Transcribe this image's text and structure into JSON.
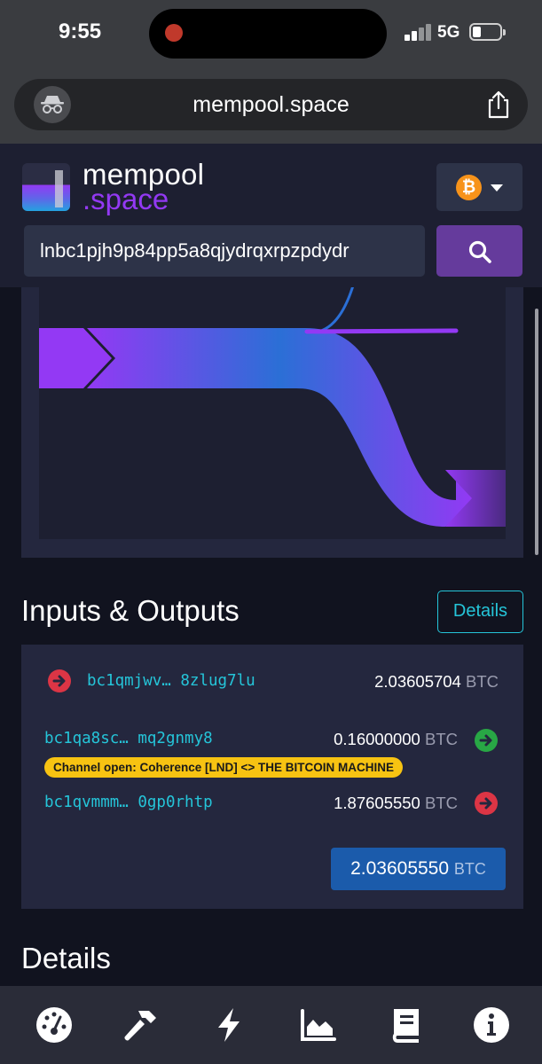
{
  "status_bar": {
    "time": "9:55",
    "network": "5G"
  },
  "browser": {
    "url": "mempool.space"
  },
  "header": {
    "logo_line1": "mempool",
    "logo_line2": ".space",
    "search_value": "lnbc1pjh9p84pp5a8qjydrqxrpzpdydr",
    "network_symbol": "₿"
  },
  "io": {
    "title": "Inputs & Outputs",
    "details_button": "Details",
    "input": {
      "address": "bc1qmjwv… 8zlug7lu",
      "amount": "2.03605704",
      "unit": "BTC"
    },
    "outputs": [
      {
        "address": "bc1qa8sc… mq2gnmy8",
        "amount": "0.16000000",
        "unit": "BTC",
        "tag": "Channel open: Coherence [LND] <> THE BITCOIN MACHINE",
        "status": "spent"
      },
      {
        "address": "bc1qvmmm… 0gp0rhtp",
        "amount": "1.87605550",
        "unit": "BTC",
        "status": "unspent"
      }
    ],
    "total": {
      "amount": "2.03605550",
      "unit": "BTC"
    }
  },
  "details_section": {
    "title": "Details"
  },
  "nav": [
    "dashboard-icon",
    "hammer-icon",
    "lightning-icon",
    "graphs-icon",
    "docs-icon",
    "info-icon"
  ],
  "colors": {
    "accent_purple": "#9339f4",
    "cyan": "#25c5d9",
    "btc_orange": "#f7931a",
    "tag_yellow": "#f7c312",
    "total_blue": "#1b5bab"
  }
}
